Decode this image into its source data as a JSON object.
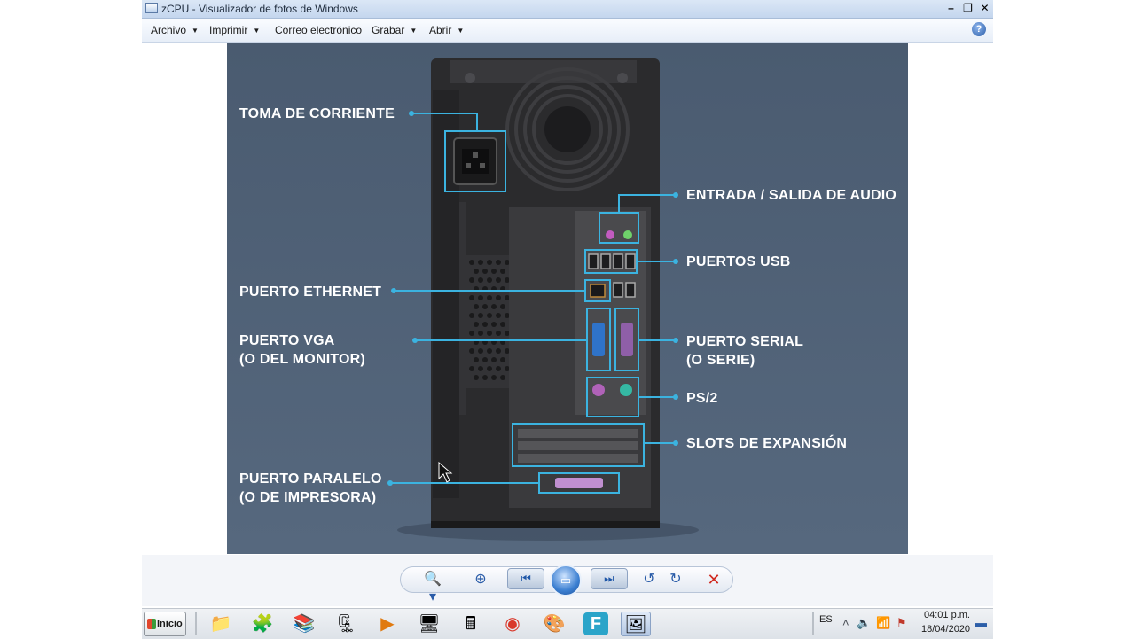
{
  "window": {
    "title": "zCPU - Visualizador de fotos de Windows",
    "controls": {
      "minimize": "–",
      "maximize": "❐",
      "close": "✕"
    },
    "menu": [
      {
        "label": "Archivo",
        "has_dropdown": true
      },
      {
        "label": "Imprimir",
        "has_dropdown": true
      },
      {
        "label": "Correo electrónico",
        "has_dropdown": false
      },
      {
        "label": "Grabar",
        "has_dropdown": true
      },
      {
        "label": "Abrir",
        "has_dropdown": true
      }
    ],
    "help_label": "?"
  },
  "image": {
    "labels": {
      "power": "TOMA DE CORRIENTE",
      "audio": "ENTRADA / SALIDA DE AUDIO",
      "usb": "PUERTOS USB",
      "ethernet": "PUERTO ETHERNET",
      "vga_1": "PUERTO VGA",
      "vga_2": "(O DEL MONITOR)",
      "serial_1": "PUERTO SERIAL",
      "serial_2": "(O SERIE)",
      "ps2": "PS/2",
      "slots": "SLOTS DE EXPANSIÓN",
      "parallel_1": "PUERTO PARALELO",
      "parallel_2": "(O  DE IMPRESORA)"
    },
    "colors": {
      "background": "#4f6176",
      "tower": "#2b2b2d",
      "callout": "#3bb3e0",
      "text": "#ffffff"
    }
  },
  "viewer_controls": {
    "zoom": "🔍▾",
    "fit": "⊕",
    "previous": "⏮",
    "slideshow": "▭",
    "next": "⏭",
    "rotate_left": "↺",
    "rotate_right": "↻",
    "delete": "✕"
  },
  "taskbar": {
    "start_label": "Inicio",
    "apps": [
      {
        "name": "explorer",
        "glyph": "📁"
      },
      {
        "name": "puzzle",
        "glyph": "🧩"
      },
      {
        "name": "books",
        "glyph": "📚"
      },
      {
        "name": "winrar",
        "glyph": "🗜"
      },
      {
        "name": "media-player",
        "glyph": "▶"
      },
      {
        "name": "control-panel",
        "glyph": "🖥"
      },
      {
        "name": "calculator",
        "glyph": "🖩"
      },
      {
        "name": "chrome",
        "glyph": "◉"
      },
      {
        "name": "paint",
        "glyph": "🎨"
      },
      {
        "name": "app-f",
        "glyph": "F"
      },
      {
        "name": "photo-viewer",
        "glyph": "🖼"
      }
    ],
    "language": "ES",
    "time": "04:01 p.m.",
    "date": "18/04/2020"
  }
}
